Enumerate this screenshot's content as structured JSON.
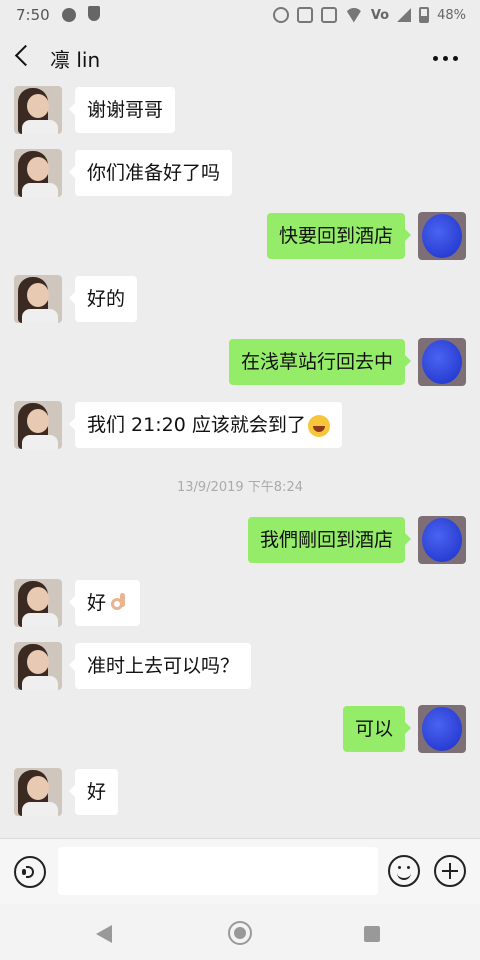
{
  "status_bar": {
    "time": "7:50",
    "battery": "48%",
    "icons": [
      "notification-dot-icon",
      "shield-icon",
      "alarm-icon",
      "nfc-icon",
      "vibrate-icon",
      "wifi-icon",
      "volte-icon",
      "signal-icon",
      "battery-icon"
    ],
    "volte": "Vo"
  },
  "header": {
    "title": "凛 lin",
    "back_icon": "chevron-left-icon",
    "more_icon": "more-dots-icon"
  },
  "messages": [
    {
      "side": "left",
      "text": "谢谢哥哥"
    },
    {
      "side": "left",
      "text": "你们准备好了吗"
    },
    {
      "side": "right",
      "text": "快要回到酒店"
    },
    {
      "side": "left",
      "text": "好的"
    },
    {
      "side": "right",
      "text": "在浅草站行回去中"
    },
    {
      "side": "left",
      "text": "我们 21:20 应该就会到了",
      "emoji": "laughing-tears-emoji"
    },
    {
      "side": "right",
      "text": "我們剛回到酒店"
    },
    {
      "side": "left",
      "text": "好",
      "emoji": "ok-hand-emoji"
    },
    {
      "side": "left",
      "text": "准时上去可以吗？"
    },
    {
      "side": "right",
      "text": "可以"
    },
    {
      "side": "left",
      "text": "好"
    }
  ],
  "timestamp": "13/9/2019 下午8:24",
  "input_bar": {
    "placeholder": "",
    "voice_icon": "voice-icon",
    "emoji_icon": "emoji-icon",
    "plus_icon": "plus-icon"
  },
  "nav_bar": {
    "icons": [
      "back-triangle-icon",
      "home-circle-icon",
      "recents-square-icon"
    ]
  },
  "colors": {
    "background": "#ededed",
    "my_bubble": "#95ec69",
    "their_bubble": "#ffffff"
  }
}
